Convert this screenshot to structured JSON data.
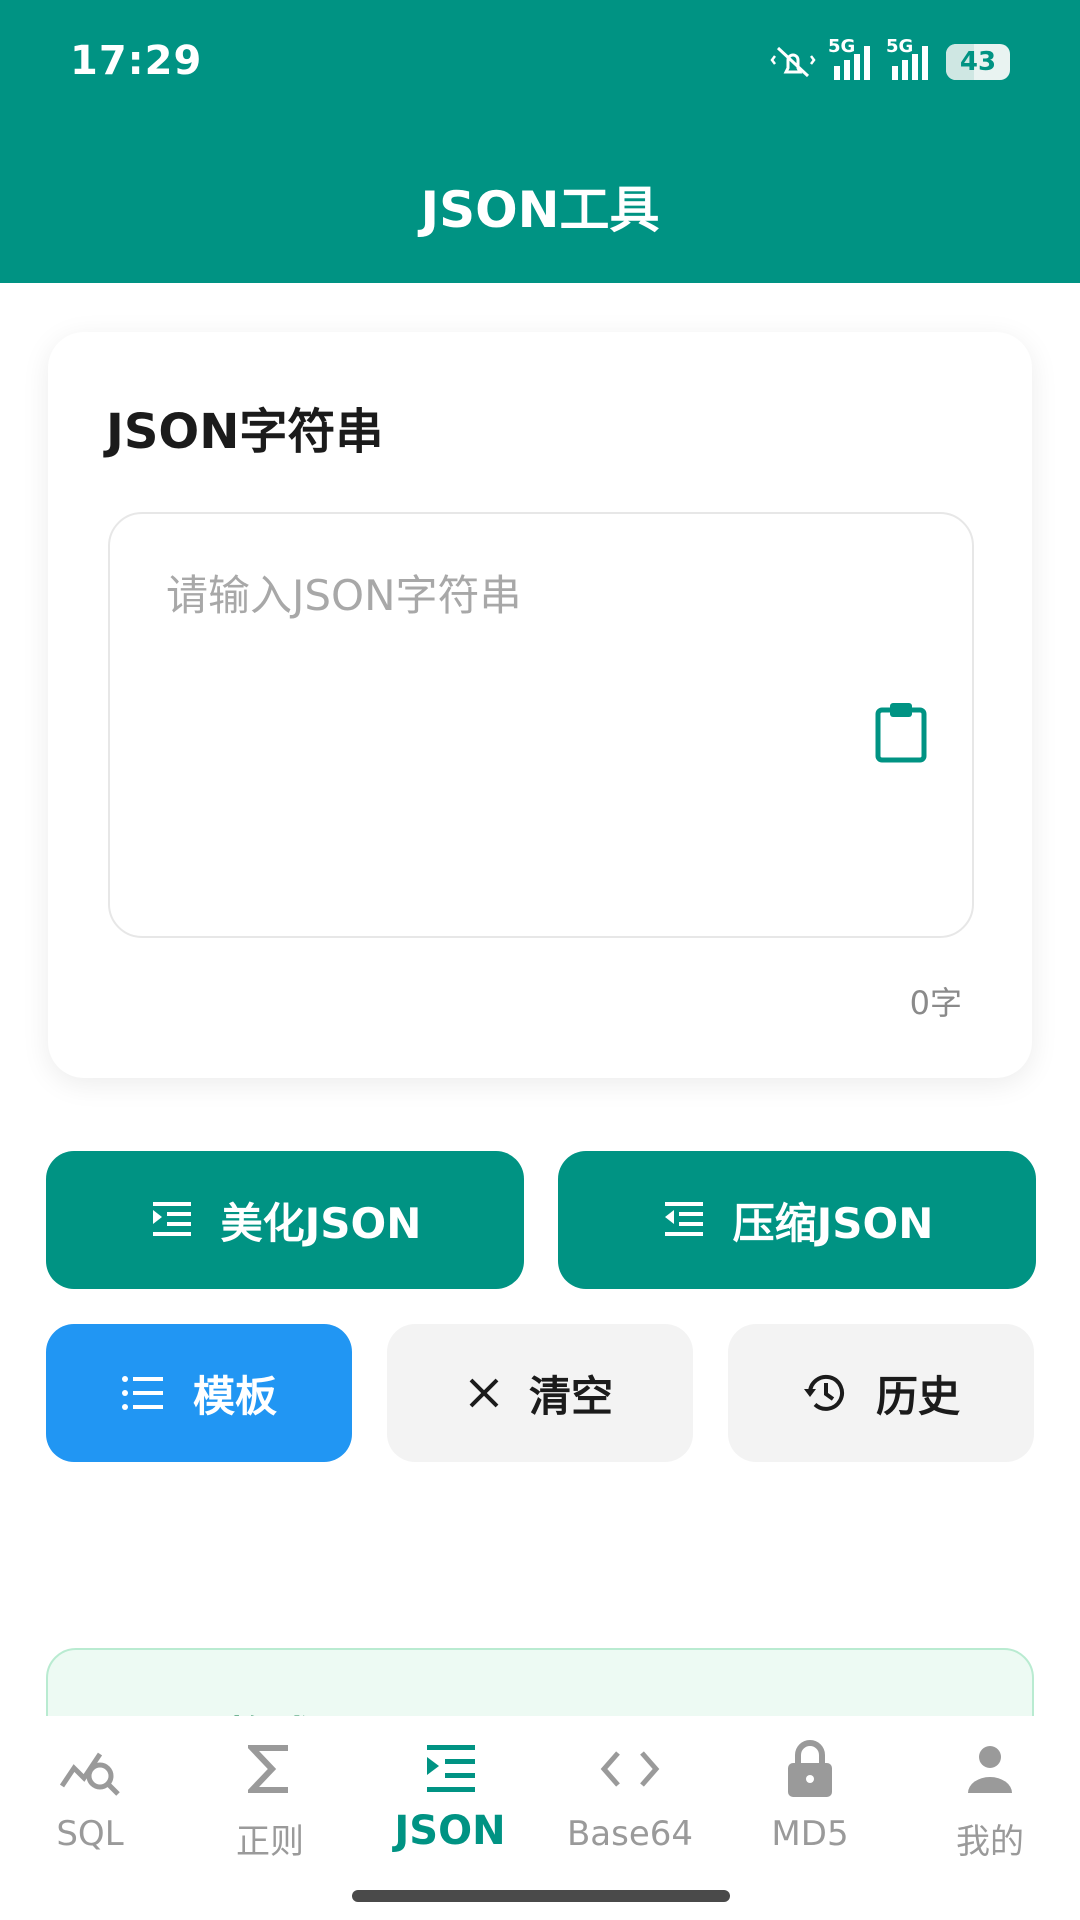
{
  "status_bar": {
    "time": "17:29",
    "network1": "5G",
    "network2": "5G",
    "battery": "43",
    "battery_level_percent": 43
  },
  "header": {
    "title": "JSON工具"
  },
  "input_card": {
    "title": "JSON字符串",
    "placeholder": "请输入JSON字符串",
    "value": "",
    "char_count": "0字",
    "paste_icon": "clipboard-icon"
  },
  "actions": {
    "beautify": {
      "label": "美化JSON",
      "icon": "indent-icon"
    },
    "compress": {
      "label": "压缩JSON",
      "icon": "outdent-icon"
    },
    "template": {
      "label": "模板",
      "icon": "list-icon"
    },
    "clear": {
      "label": "清空",
      "icon": "close-icon"
    },
    "history": {
      "label": "历史",
      "icon": "history-icon"
    }
  },
  "result_card": {
    "title": "JSON格式"
  },
  "nav": {
    "items": [
      {
        "label": "SQL",
        "icon": "chart-search-icon"
      },
      {
        "label": "正则",
        "icon": "sigma-icon"
      },
      {
        "label": "JSON",
        "icon": "indent-icon",
        "active": true
      },
      {
        "label": "Base64",
        "icon": "code-icon"
      },
      {
        "label": "MD5",
        "icon": "lock-icon"
      },
      {
        "label": "我的",
        "icon": "person-icon"
      }
    ]
  },
  "colors": {
    "primary": "#009383",
    "blue": "#2196f3",
    "gray_button": "#f3f3f3",
    "result_bg": "#edfaf3"
  }
}
